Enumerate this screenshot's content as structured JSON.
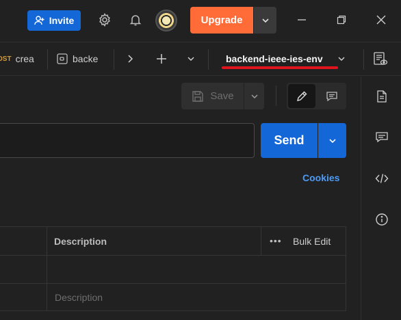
{
  "header": {
    "invite_label": "Invite",
    "upgrade_label": "Upgrade"
  },
  "tabs": [
    {
      "method": "OST",
      "label": "crea"
    },
    {
      "label": "backe"
    }
  ],
  "environment": {
    "name": "backend-ieee-ies-env"
  },
  "toolbar": {
    "save_label": "Save"
  },
  "request": {
    "url_value": "",
    "send_label": "Send",
    "cookies_label": "Cookies"
  },
  "params_table": {
    "header_description": "Description",
    "header_more": "•••",
    "bulk_edit_label": "Bulk Edit",
    "description_placeholder": "Description"
  },
  "colors": {
    "brand_orange": "#ff6c37",
    "primary_blue": "#1467d6",
    "link_blue": "#4d9bf5",
    "highlight_red": "#e0141c",
    "background": "#212121"
  },
  "icons": [
    "add-user-icon",
    "gear-icon",
    "bell-icon",
    "chevron-down-icon",
    "minimize-icon",
    "restore-icon",
    "close-icon",
    "request-icon",
    "chevron-right-icon",
    "plus-icon",
    "environment-quick-look-icon",
    "save-icon",
    "pencil-icon",
    "comment-icon",
    "document-icon",
    "code-icon",
    "info-icon"
  ]
}
